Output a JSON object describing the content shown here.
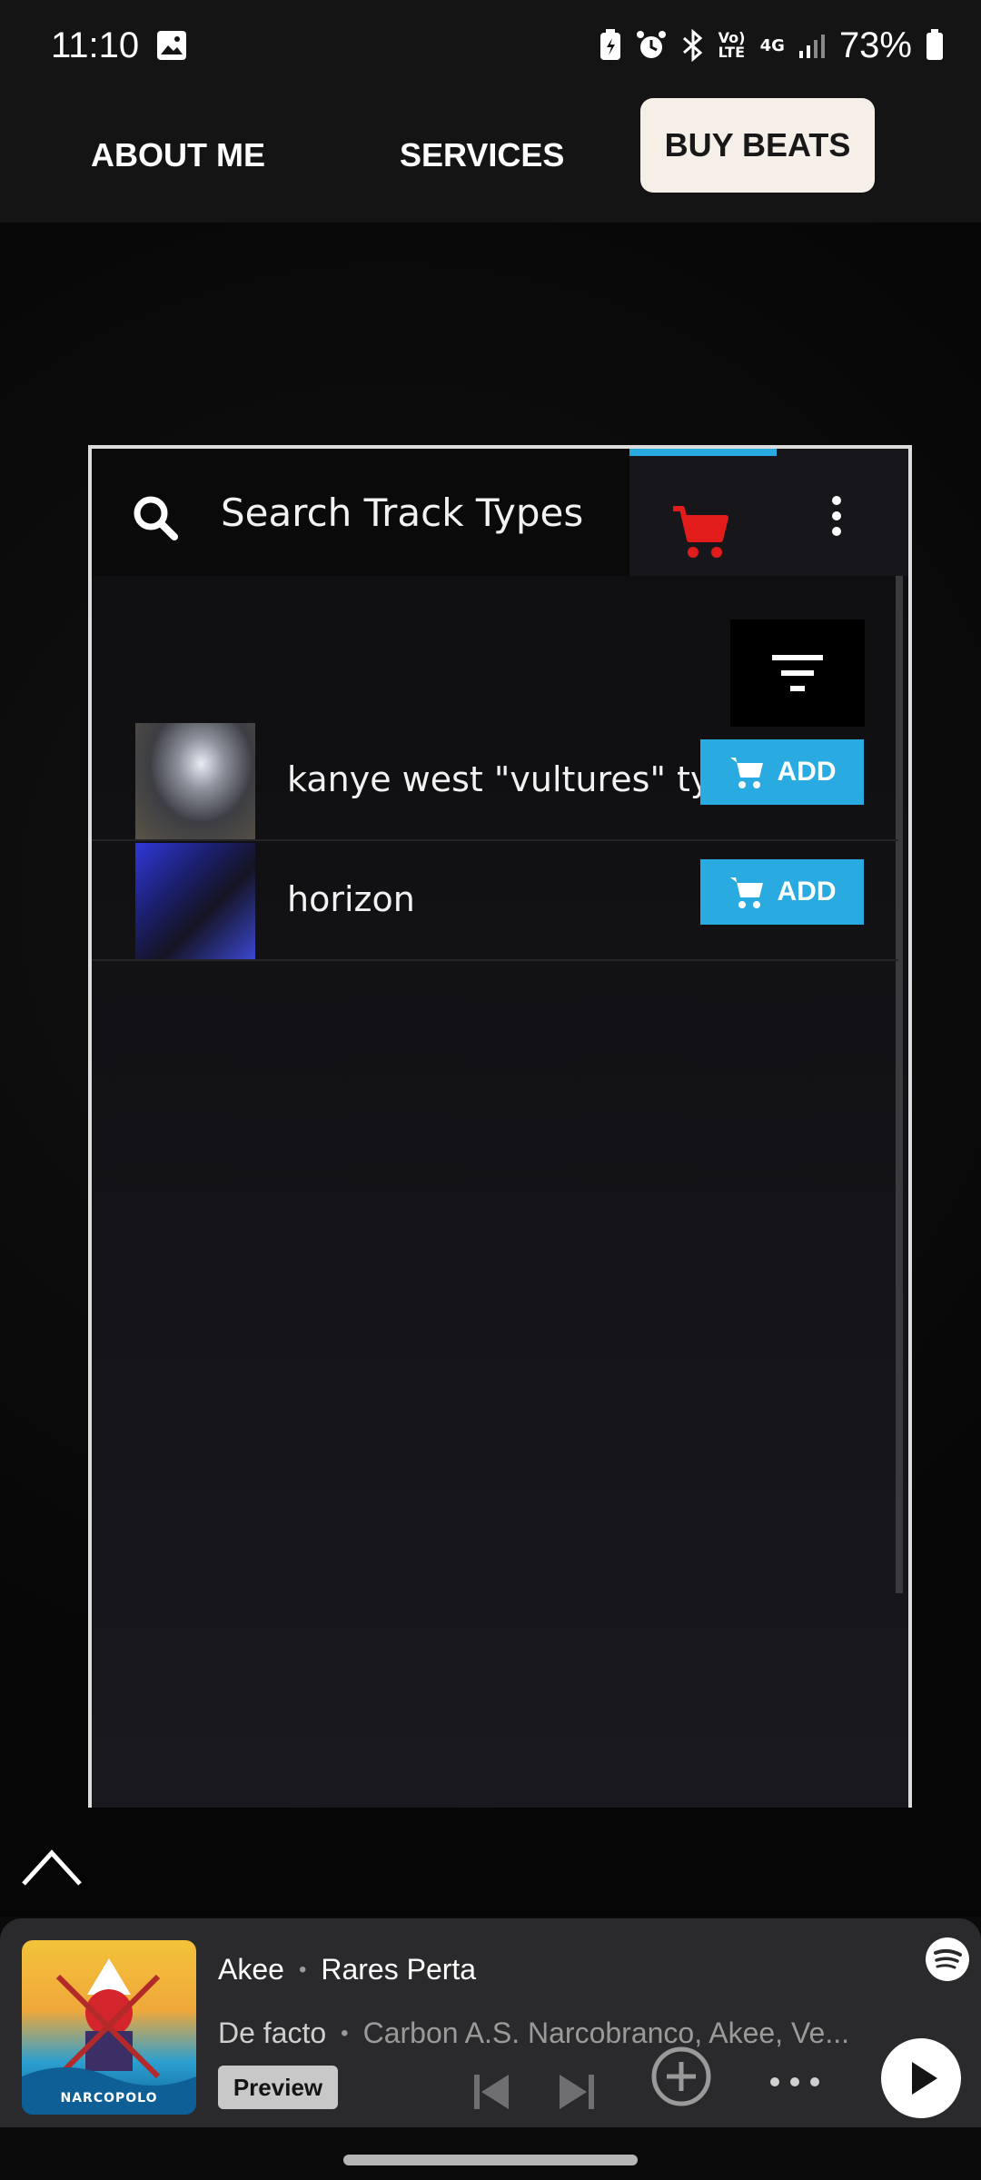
{
  "status_bar": {
    "time": "11:10",
    "battery": "73%",
    "icons": [
      "gallery-icon",
      "battery-saver-icon",
      "alarm-icon",
      "bluetooth-icon",
      "volte-icon",
      "4g-icon",
      "signal-icon",
      "battery-icon"
    ],
    "volte_text": "Vo) LTE",
    "network_text": "4G"
  },
  "nav": {
    "about": "ABOUT ME",
    "services": "SERVICES",
    "buy_beats": "BUY BEATS"
  },
  "widget": {
    "search_placeholder": "Search Track Types",
    "accent_color": "#29abe2",
    "cart_color": "#e21b1b",
    "tracks": [
      {
        "title": "kanye west \"vultures\" type beat",
        "add_label": "ADD"
      },
      {
        "title": "horizon",
        "add_label": "ADD"
      }
    ]
  },
  "player": {
    "artist_primary": "Akee",
    "artist_secondary": "Rares Perta",
    "song_title": "De facto",
    "song_artists": "Carbon A.S. Narcobranco, Akee, Ve...",
    "preview_label": "Preview",
    "album_label": "NARCOPOLO"
  }
}
